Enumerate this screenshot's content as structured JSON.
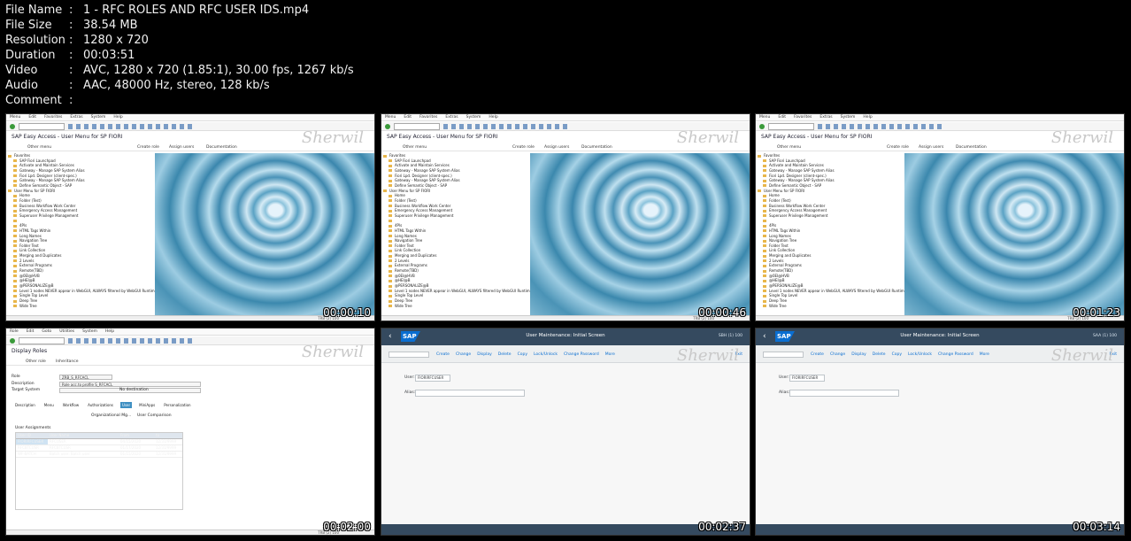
{
  "meta": [
    {
      "key": "File Name",
      "value": "1 - RFC ROLES AND RFC USER IDS.mp4"
    },
    {
      "key": "File Size",
      "value": "38.54 MB"
    },
    {
      "key": "Resolution",
      "value": "1280 x 720"
    },
    {
      "key": "Duration",
      "value": "00:03:51"
    },
    {
      "key": "Video",
      "value": "AVC, 1280 x 720 (1.85:1), 30.00 fps, 1267 kb/s"
    },
    {
      "key": "Audio",
      "value": "AAC, 48000 Hz, stereo, 128 kb/s"
    },
    {
      "key": "Comment",
      "value": ""
    }
  ],
  "separator": ":",
  "gui": {
    "menu": [
      "Menu",
      "Edit",
      "Favorites",
      "Extras",
      "System",
      "Help"
    ],
    "title": "SAP Easy Access - User Menu for SP FIORI",
    "app_actions": [
      "Other menu",
      "Create role",
      "Assign users",
      "Documentation"
    ],
    "watermark": "Sherwil",
    "status": "TRB (2) 100",
    "tree": [
      "Favorites",
      "SAP Fiori Launchpad",
      "Activate and Maintain Services",
      "Gateway - Manage SAP System Alias",
      "Fiori Lpd. Designer (client-spec.)",
      "Gateway - Manage SAP System Alias",
      "Define Semantic Object - SAP",
      "User Menu for SP FIORI",
      "Home",
      "Folder (Test)",
      "Business Workflow Work Center",
      "Emergency Access Management",
      "Superuser Privilege Management",
      "",
      "4Pls",
      "HTML Tags Within",
      "Long Names",
      "Navigation Tree",
      "Folder Text",
      "Link Collection",
      "Merging and Duplicates",
      "2 Levels",
      "External Programs",
      "Remote(TBD)",
      "@0EI@HVB",
      "@HEI@B",
      "@PERSONALIZE@B",
      "Level 1 nodes NEVER appear in WebGUI, ALWAYS filtered by WebGUI Runtime",
      "Single Top Level",
      "Deep Tree",
      "Wide Tree"
    ]
  },
  "roles": {
    "menu": [
      "Role",
      "Edit",
      "Goto",
      "Utilities",
      "System",
      "Help"
    ],
    "title": "Display Roles",
    "actions": [
      "Other role",
      "Inheritance"
    ],
    "fields": [
      {
        "label": "Role",
        "value": "ZRB_S_RFCACL"
      },
      {
        "label": "Description",
        "value": "Role acc.to profile S_RFCACL"
      },
      {
        "label": "Target System",
        "value": ""
      }
    ],
    "no_dest": "No destination",
    "tabs": [
      "Description",
      "Menu",
      "Workflow",
      "Authorizations",
      "User",
      "MiniApps",
      "Personalization"
    ],
    "active_tab": "User",
    "sub_buttons": [
      "Organizational Mg...",
      "User Comparison"
    ],
    "table_title": "User Assignments",
    "columns": [
      "User ID",
      "User Name",
      "From",
      "to"
    ],
    "rows": [
      [
        "FIORIRFCUSER",
        "RFCUSER",
        "04/15/2020",
        "12/31/9999"
      ],
      [
        "RFCBTCUSR",
        "RFCBTCUSR",
        "01/17/2020",
        "12/31/9999"
      ],
      [
        "WF-BATCH",
        "Batch user: Batch user",
        "01/15/2020",
        "12/31/9999"
      ]
    ]
  },
  "fiori": {
    "title": "User Maintenance: Initial Screen",
    "sap": "SAP",
    "right": "SBH (1) 100",
    "right2": "SAA (1) 100",
    "actions": [
      "Create",
      "Change",
      "Display",
      "Delete",
      "Copy",
      "Lock/Unlock",
      "Change Password",
      "More"
    ],
    "exit": "Exit",
    "user_label": "User:",
    "user_value": "FIORIRFCUSER",
    "alias_label": "Alias:"
  },
  "thumbs": [
    {
      "type": "gui",
      "time": "00:00:10"
    },
    {
      "type": "gui",
      "time": "00:00:46"
    },
    {
      "type": "gui",
      "time": "00:01:23"
    },
    {
      "type": "roles",
      "time": "00:02:00"
    },
    {
      "type": "fiori",
      "time": "00:02:37"
    },
    {
      "type": "fiori",
      "time": "00:03:14"
    }
  ]
}
